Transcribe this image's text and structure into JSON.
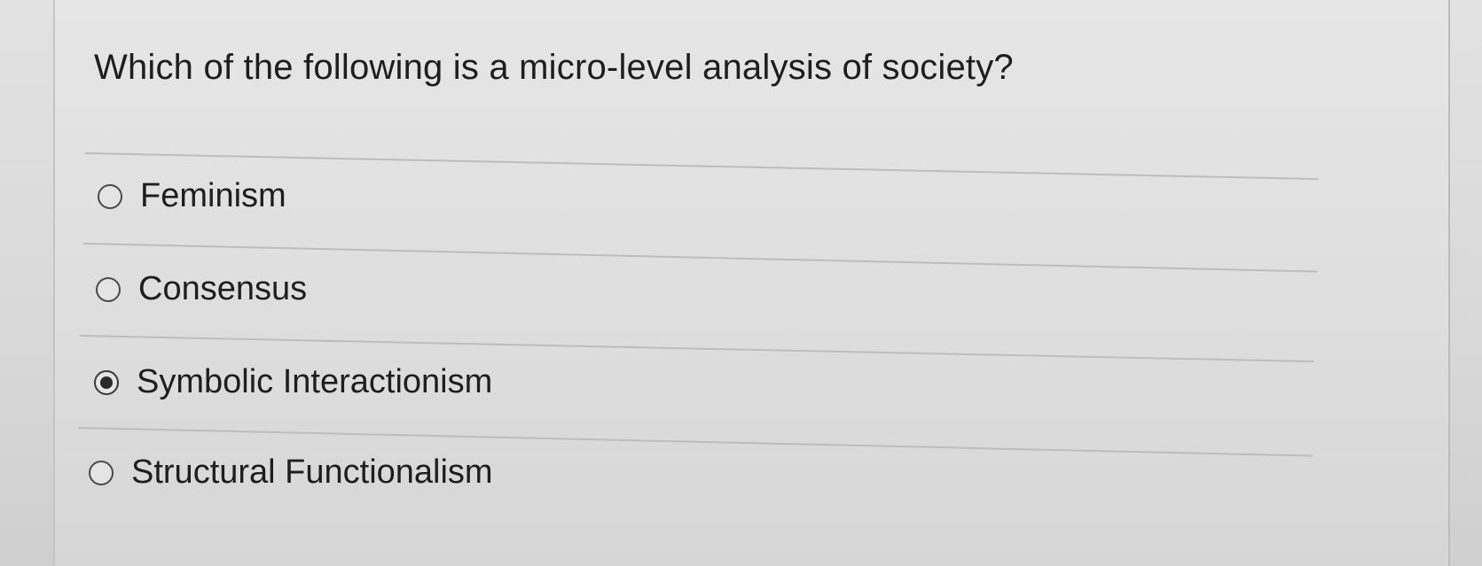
{
  "question": {
    "text": "Which of the following is a micro-level analysis of society?"
  },
  "options": [
    {
      "label": "Feminism",
      "selected": false
    },
    {
      "label": "Consensus",
      "selected": false
    },
    {
      "label": "Symbolic Interactionism",
      "selected": true
    },
    {
      "label": "Structural Functionalism",
      "selected": false
    }
  ],
  "colors": {
    "background": "#dcdcdc",
    "text": "#1e1e1e",
    "divider": "#bdbdbd",
    "radio_border": "#4a4a4a",
    "radio_selected_dot": "#2a2a2a"
  }
}
